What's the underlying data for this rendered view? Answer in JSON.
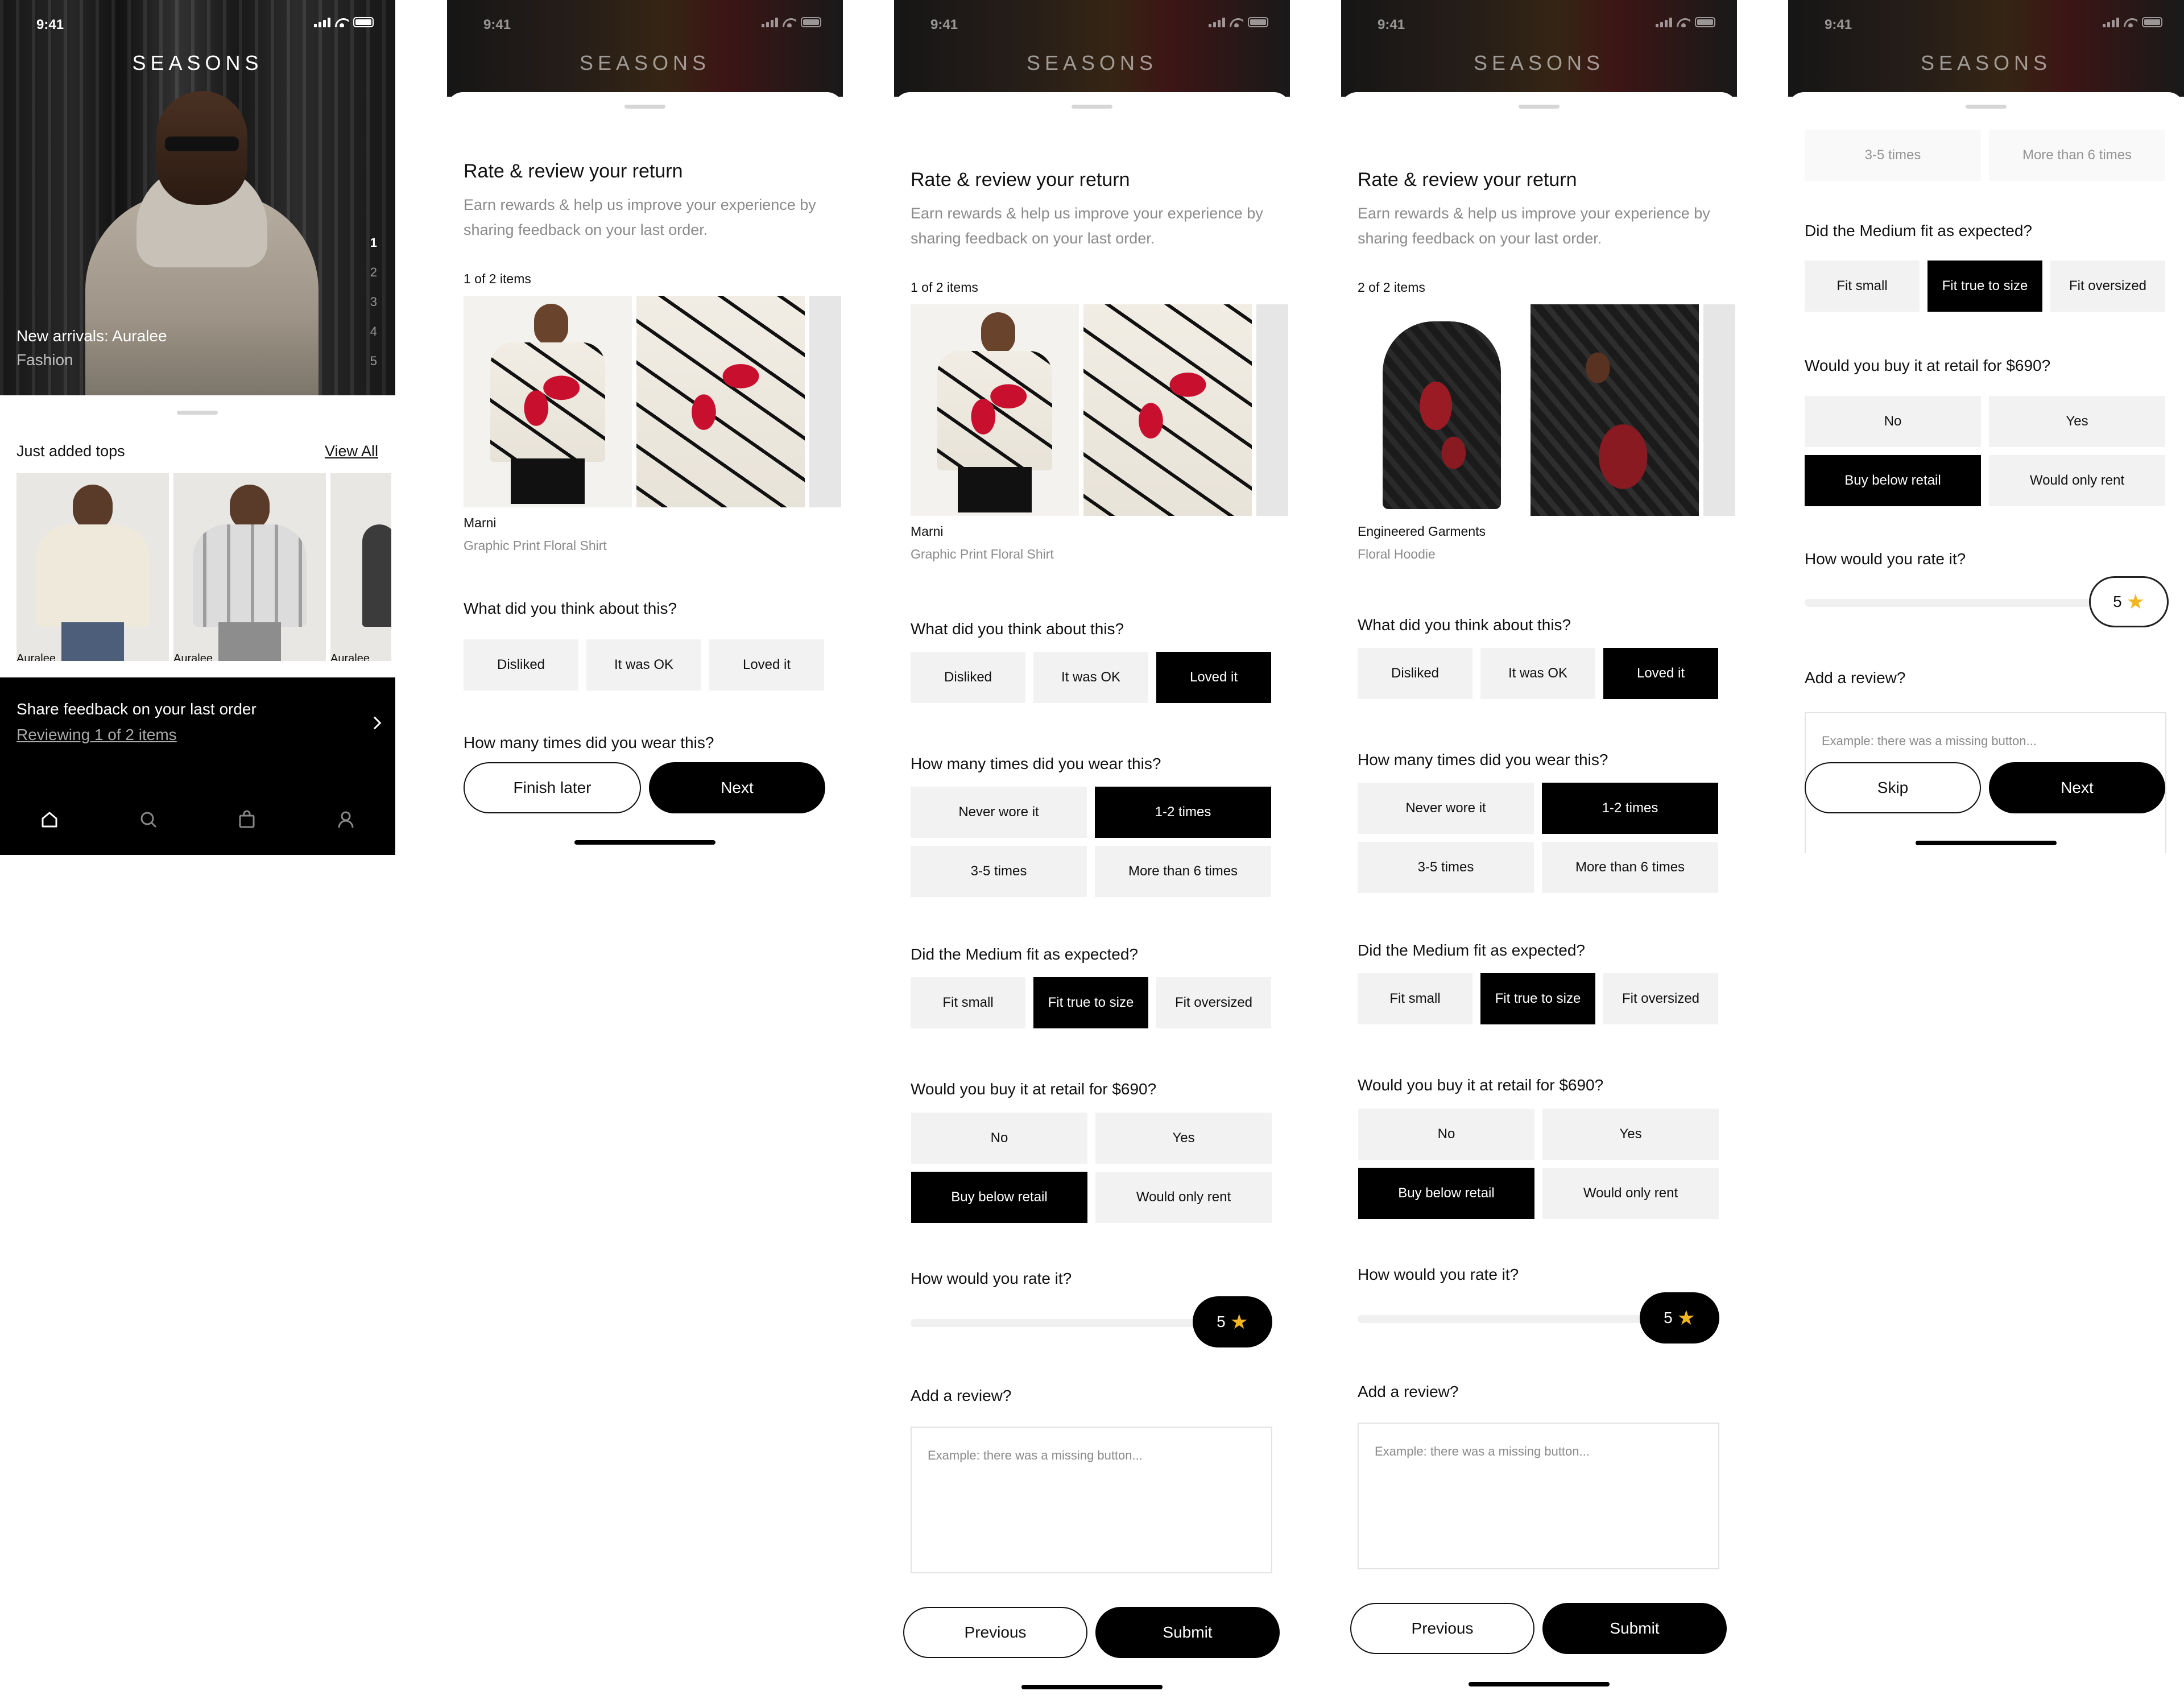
{
  "status_time": "9:41",
  "brand": "SEASONS",
  "home": {
    "hero_title": "New arrivals: Auralee",
    "hero_subtitle": "Fashion",
    "pager": [
      "1",
      "2",
      "3",
      "4",
      "5"
    ],
    "section_title": "Just added tops",
    "view_all": "View All",
    "products": [
      {
        "label": "Auralee"
      },
      {
        "label": "Auralee"
      },
      {
        "label": "Auralee"
      }
    ],
    "feedback_title": "Share feedback on your last order",
    "feedback_sub": "Reviewing 1 of 2 items",
    "tabs": [
      "home-icon",
      "search-icon",
      "bag-icon",
      "profile-icon"
    ]
  },
  "review": {
    "title": "Rate & review your return",
    "subtitle": "Earn rewards & help us improve your experience by sharing feedback on your last order.",
    "q_think": "What did you think about this?",
    "think_opts": [
      "Disliked",
      "It was OK",
      "Loved it"
    ],
    "q_wear": "How many times did you wear this?",
    "wear_opts": [
      "Never wore it",
      "1-2 times",
      "3-5 times",
      "More than 6 times"
    ],
    "q_fit": "Did the Medium fit as expected?",
    "fit_opts": [
      "Fit small",
      "Fit true to size",
      "Fit oversized"
    ],
    "q_buy": "Would you buy it at retail for $690?",
    "buy_opts": [
      "No",
      "Yes",
      "Buy below retail",
      "Would only rent"
    ],
    "q_rate": "How would you rate it?",
    "rating": "5",
    "q_review": "Add a review?",
    "review_placeholder": "Example: there was a missing button...",
    "btn_finish_later": "Finish later",
    "btn_next": "Next",
    "btn_previous": "Previous",
    "btn_submit": "Submit",
    "btn_skip": "Skip"
  },
  "items": [
    {
      "count": "1 of 2 items",
      "brand": "Marni",
      "name": "Graphic Print Floral Shirt"
    },
    {
      "count": "2 of 2 items",
      "brand": "Engineered Garments",
      "name": "Floral Hoodie"
    }
  ],
  "colors": {
    "accent": "#000000",
    "option_bg": "#f2f2f2",
    "muted_text": "#8a8a8a",
    "star": "#f3b61f"
  }
}
